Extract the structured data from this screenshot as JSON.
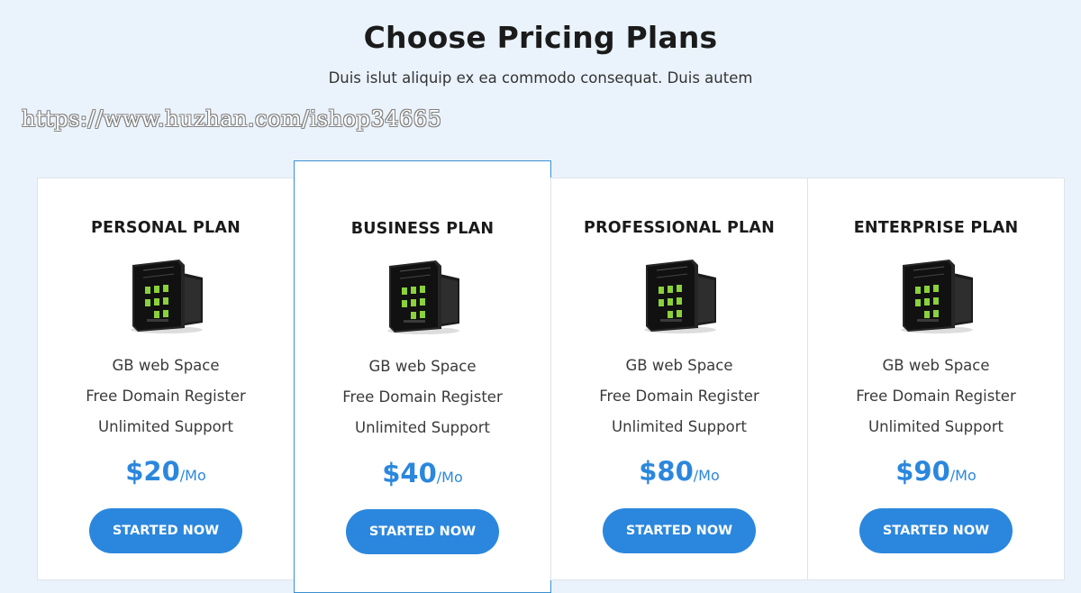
{
  "header": {
    "title": "Choose Pricing Plans",
    "subtitle": "Duis islut aliquip ex ea commodo consequat. Duis autem"
  },
  "watermark": "https://www.huzhan.com/ishop34665",
  "plans": [
    {
      "name": "PERSONAL PLAN",
      "features": [
        "GB web Space",
        "Free Domain Register",
        "Unlimited Support"
      ],
      "price": "$20",
      "unit": "/Mo",
      "button": "STARTED NOW",
      "icon": "server-icon"
    },
    {
      "name": "BUSINESS PLAN",
      "features": [
        "GB web Space",
        "Free Domain Register",
        "Unlimited Support"
      ],
      "price": "$40",
      "unit": "/Mo",
      "button": "STARTED NOW",
      "icon": "server-icon"
    },
    {
      "name": "PROFESSIONAL PLAN",
      "features": [
        "GB web Space",
        "Free Domain Register",
        "Unlimited Support"
      ],
      "price": "$80",
      "unit": "/Mo",
      "button": "STARTED NOW",
      "icon": "server-icon"
    },
    {
      "name": "ENTERPRISE PLAN",
      "features": [
        "GB web Space",
        "Free Domain Register",
        "Unlimited Support"
      ],
      "price": "$90",
      "unit": "/Mo",
      "button": "STARTED NOW",
      "icon": "server-icon"
    }
  ],
  "colors": {
    "accent": "#2b87dd",
    "background": "#eaf3fc",
    "featured_border": "#3b8fd0"
  }
}
